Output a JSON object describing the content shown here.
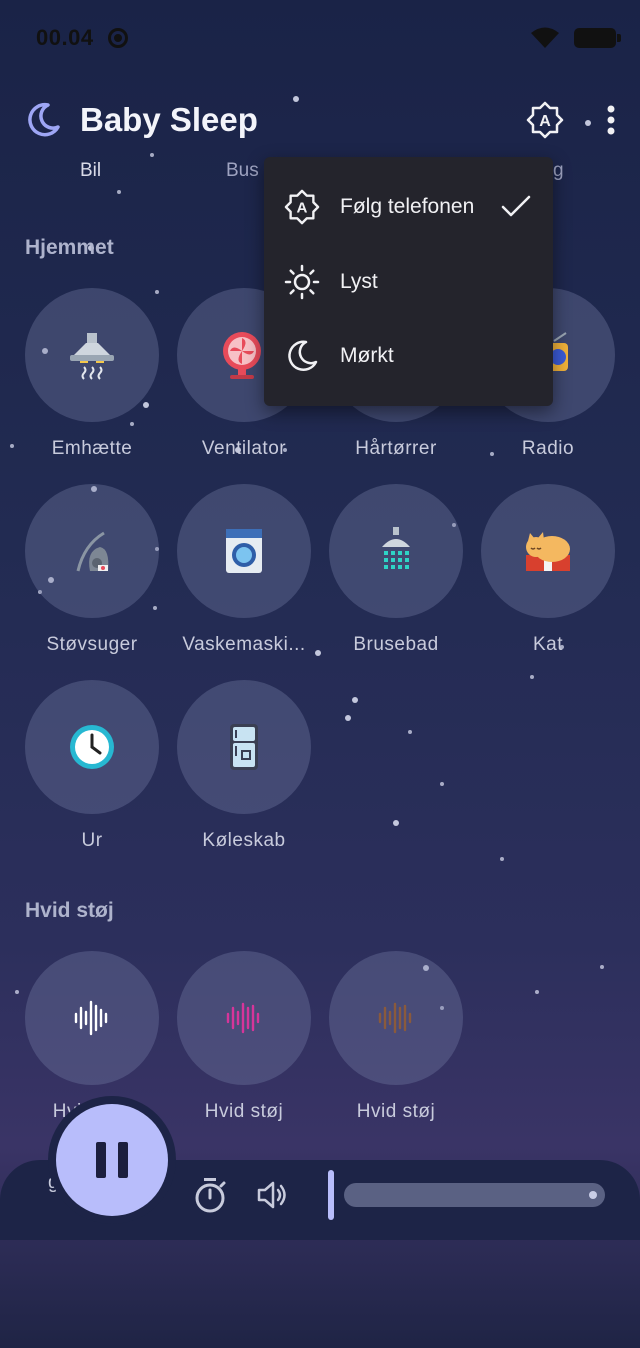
{
  "status_bar": {
    "time": "00.04"
  },
  "app_bar": {
    "title": "Baby Sleep"
  },
  "tabs": [
    {
      "label": "Bil"
    },
    {
      "label": "Bus"
    },
    {
      "label": "g"
    }
  ],
  "theme_menu": {
    "items": [
      {
        "label": "Følg telefonen",
        "icon": "auto-theme-icon",
        "selected": true
      },
      {
        "label": "Lyst",
        "icon": "sun-icon"
      },
      {
        "label": "Mørkt",
        "icon": "moon-icon"
      }
    ]
  },
  "sections": {
    "home": {
      "title": "Hjemmet",
      "items": [
        {
          "label": "Emhætte",
          "icon": "range-hood-icon"
        },
        {
          "label": "Ventilator",
          "icon": "fan-icon"
        },
        {
          "label": "Hårtørrer",
          "icon": "hair-dryer-icon"
        },
        {
          "label": "Radio",
          "icon": "radio-icon"
        },
        {
          "label": "Støvsuger",
          "icon": "vacuum-icon"
        },
        {
          "label": "Vaskemaski...",
          "icon": "washing-machine-icon"
        },
        {
          "label": "Brusebad",
          "icon": "shower-icon"
        },
        {
          "label": "Kat",
          "icon": "cat-icon"
        },
        {
          "label": "Ur",
          "icon": "clock-icon"
        },
        {
          "label": "Køleskab",
          "icon": "fridge-icon"
        }
      ]
    },
    "white_noise": {
      "title": "Hvid støj",
      "items": [
        {
          "label": "Hvid støj",
          "icon": "white-noise-icon",
          "color": "#ffffff"
        },
        {
          "label": "Hvid støj",
          "icon": "pink-noise-icon",
          "color": "#d6359a"
        },
        {
          "label": "Hvid støj",
          "icon": "brown-noise-icon",
          "color": "#8a5a3c"
        }
      ]
    }
  },
  "player": {
    "partial_label": "g",
    "volume_level": 1.0
  }
}
